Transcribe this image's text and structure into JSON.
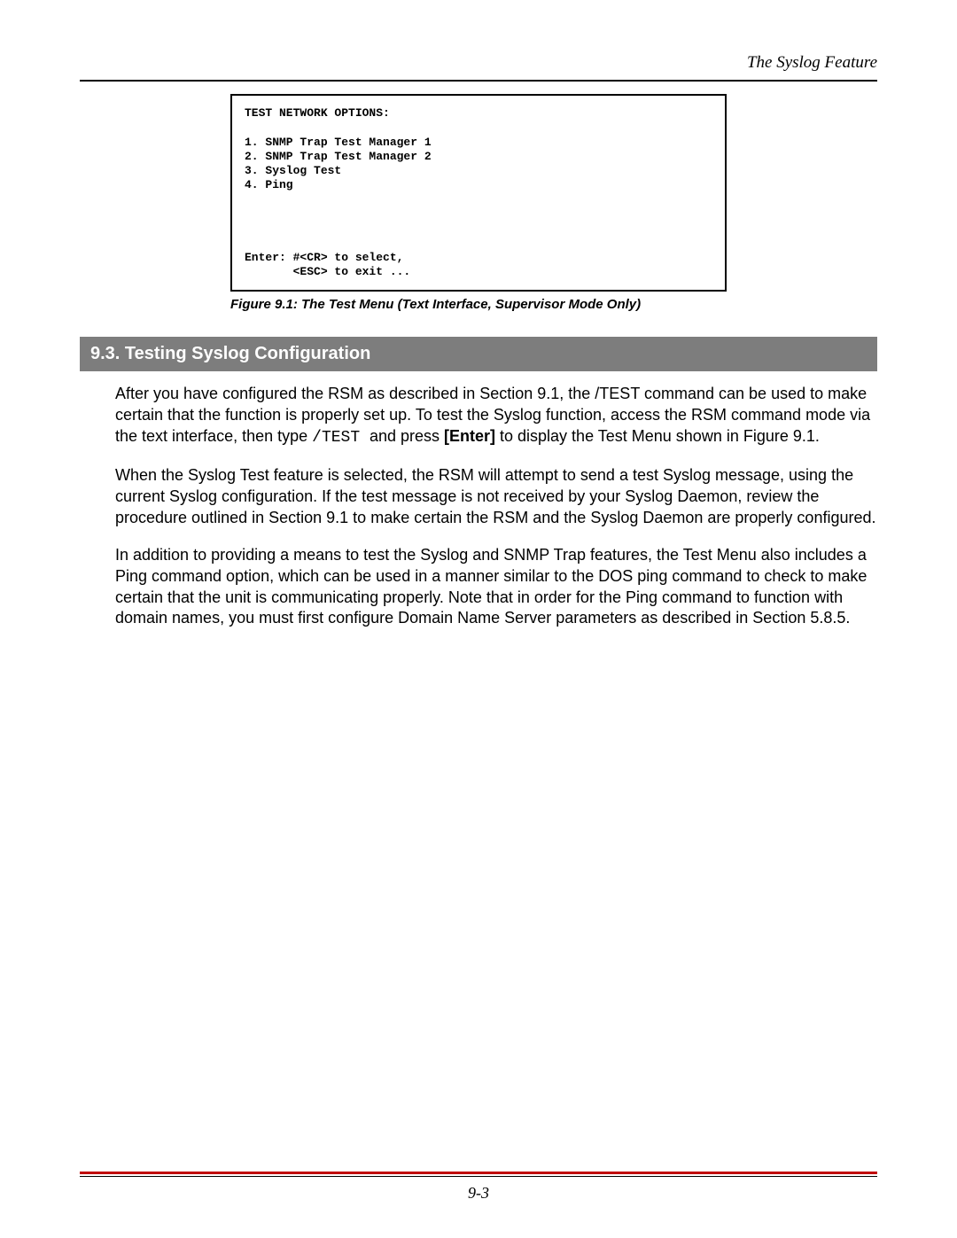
{
  "header": {
    "running_head": "The Syslog Feature"
  },
  "figure": {
    "lines": [
      "TEST NETWORK OPTIONS:",
      "",
      "1. SNMP Trap Test Manager 1",
      "2. SNMP Trap Test Manager 2",
      "3. Syslog Test",
      "4. Ping",
      "",
      "",
      "",
      "",
      "Enter: #<CR> to select,",
      "       <ESC> to exit ..."
    ],
    "caption": "Figure 9.1:  The Test Menu (Text Interface, Supervisor Mode Only)"
  },
  "section": {
    "title": "9.3.   Testing Syslog Configuration",
    "p1_a": "After you have configured the RSM as described in Section 9.1, the /TEST command can be used to make certain that the function is properly set up.  To test the Syslog function, access the RSM command mode via the text interface, then type ",
    "p1_mono": "/TEST ",
    "p1_b": " and press ",
    "p1_bold": "[Enter]",
    "p1_c": " to display the Test Menu shown in Figure 9.1.",
    "p2": "When the Syslog Test feature is selected, the RSM will attempt to send a test Syslog message, using the current Syslog configuration.  If the test message is not received by your Syslog Daemon, review the procedure outlined in Section 9.1 to make certain the RSM and the Syslog Daemon are properly configured.",
    "p3": "In addition to providing a means to test the Syslog and SNMP Trap features, the Test Menu also includes a Ping command option, which can be used in a manner similar to the DOS ping command to check to make certain that the unit is communicating properly.  Note that in order for the Ping command to function with domain names, you must first configure Domain Name Server parameters as described in Section 5.8.5."
  },
  "footer": {
    "page_number": "9-3"
  }
}
